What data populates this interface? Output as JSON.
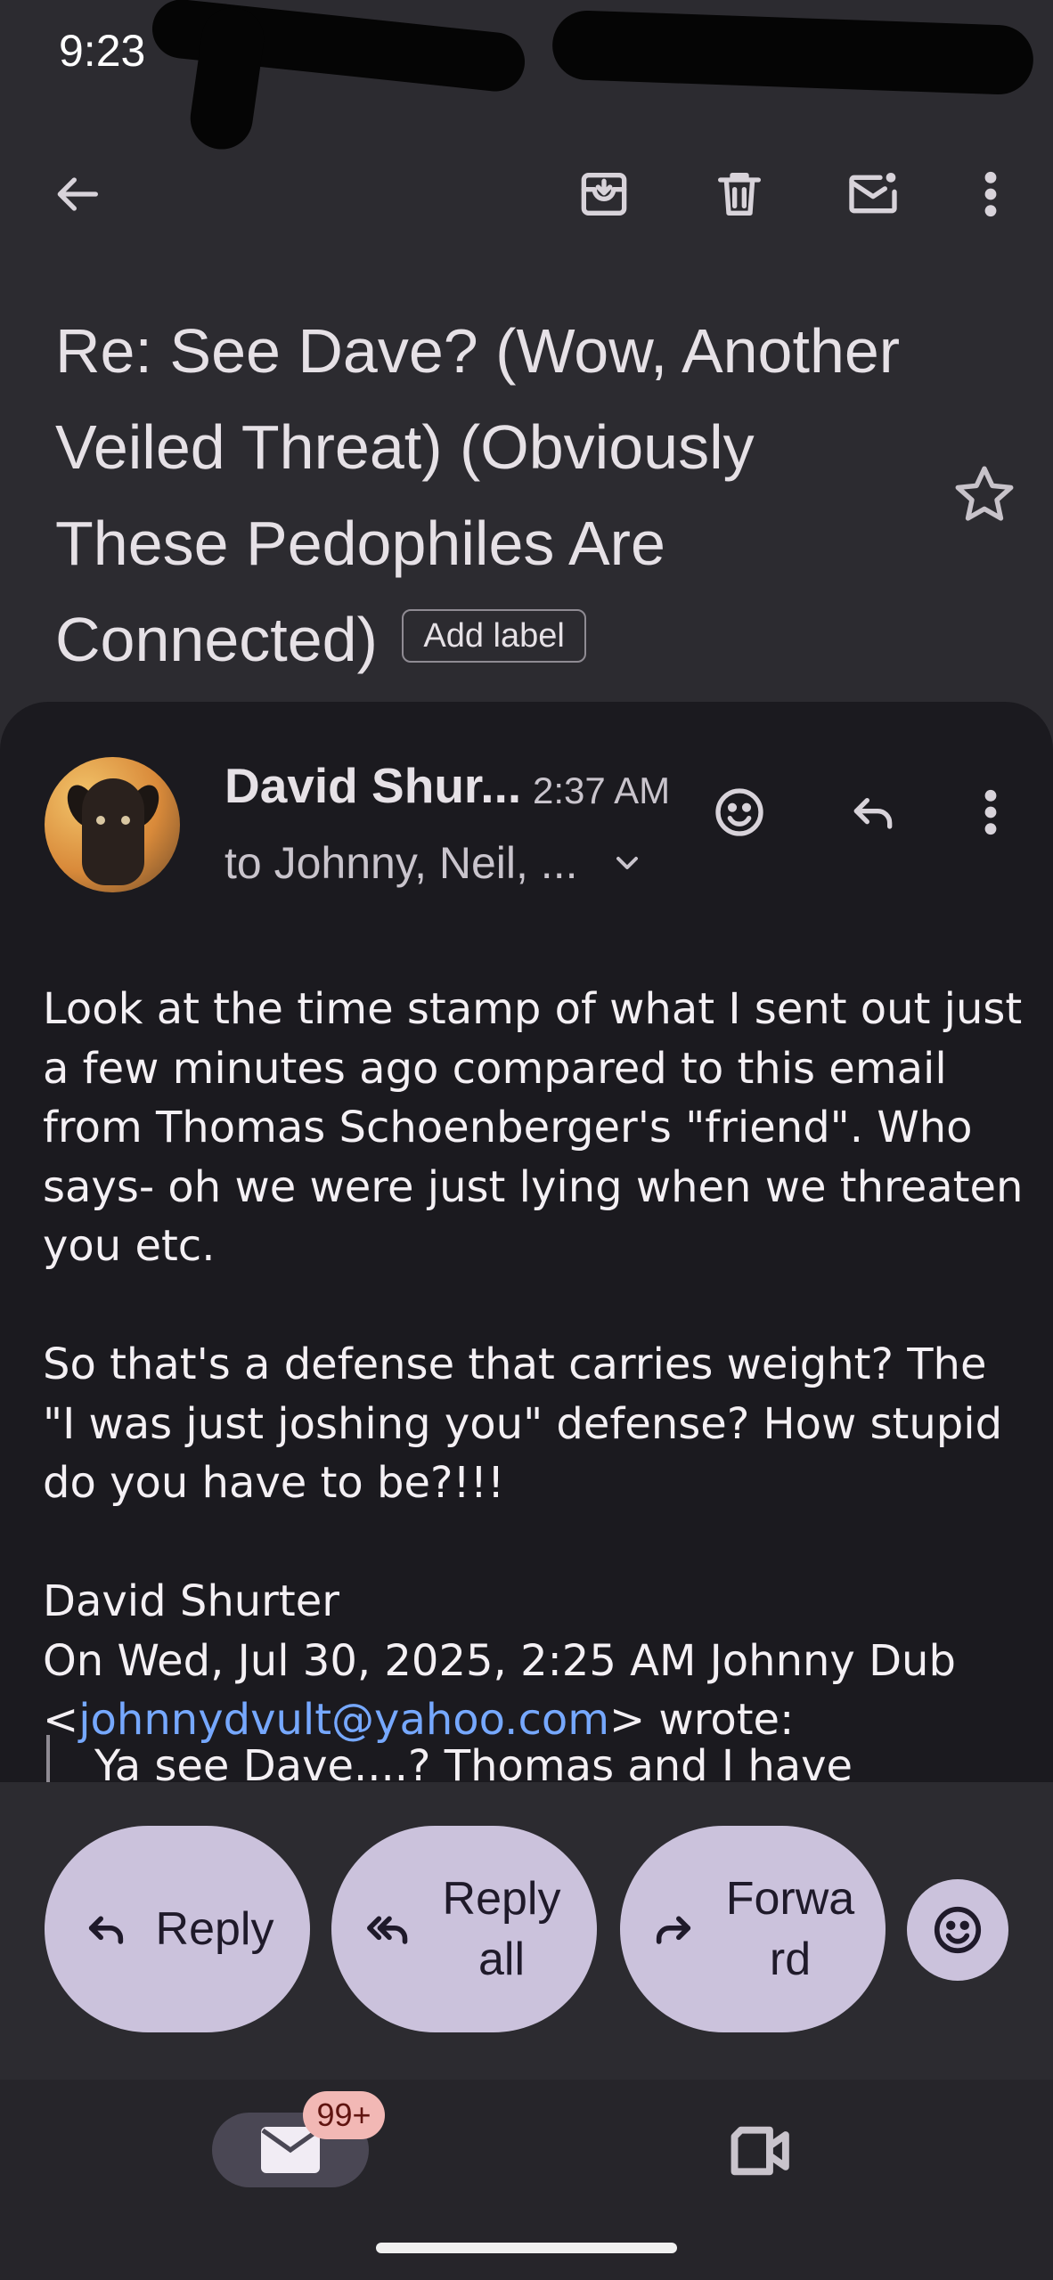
{
  "status_bar": {
    "time": "9:23"
  },
  "toolbar": {
    "back_icon": "arrow-back-icon",
    "archive_icon": "archive-icon",
    "delete_icon": "trash-icon",
    "mark_unread_icon": "mark-unread-icon",
    "more_icon": "more-vert-icon"
  },
  "subject": {
    "text": "Re: See Dave? (Wow, Another Veiled Threat) (Obviously These Pedophiles Are Connected)",
    "add_label": "Add label",
    "star_icon": "star-outline-icon"
  },
  "message": {
    "sender": "David Shur...",
    "time": "2:37 AM",
    "recipients": "to Johnny, Neil, ...",
    "body_p1": "Look at the time stamp of what I sent out just a few minutes ago compared to this email from Thomas Schoenberger's \"friend\". Who says- oh we were just lying when we threaten you etc.",
    "body_p2": "So that's a defense that carries weight? The \"I was just joshing you\" defense? How stupid do you have to be?!!!",
    "signature": "David Shurter",
    "quote_header_prefix": "On Wed, Jul 30, 2025, 2:25 AM Johnny Dub <",
    "quote_email": "johnnydvult@yahoo.com",
    "quote_header_suffix": "> wrote:",
    "quoted_text": "Ya see Dave....? Thomas and I have"
  },
  "actions": {
    "reply": "Reply",
    "reply_all": "Reply all",
    "forward": "Forwa rd"
  },
  "bottom_nav": {
    "mail_badge": "99+"
  },
  "colors": {
    "background": "#2c2b30",
    "card": "#1b1a1f",
    "pill": "#cbc2dc",
    "link": "#76a8ff",
    "badge": "#f2b8b5"
  }
}
